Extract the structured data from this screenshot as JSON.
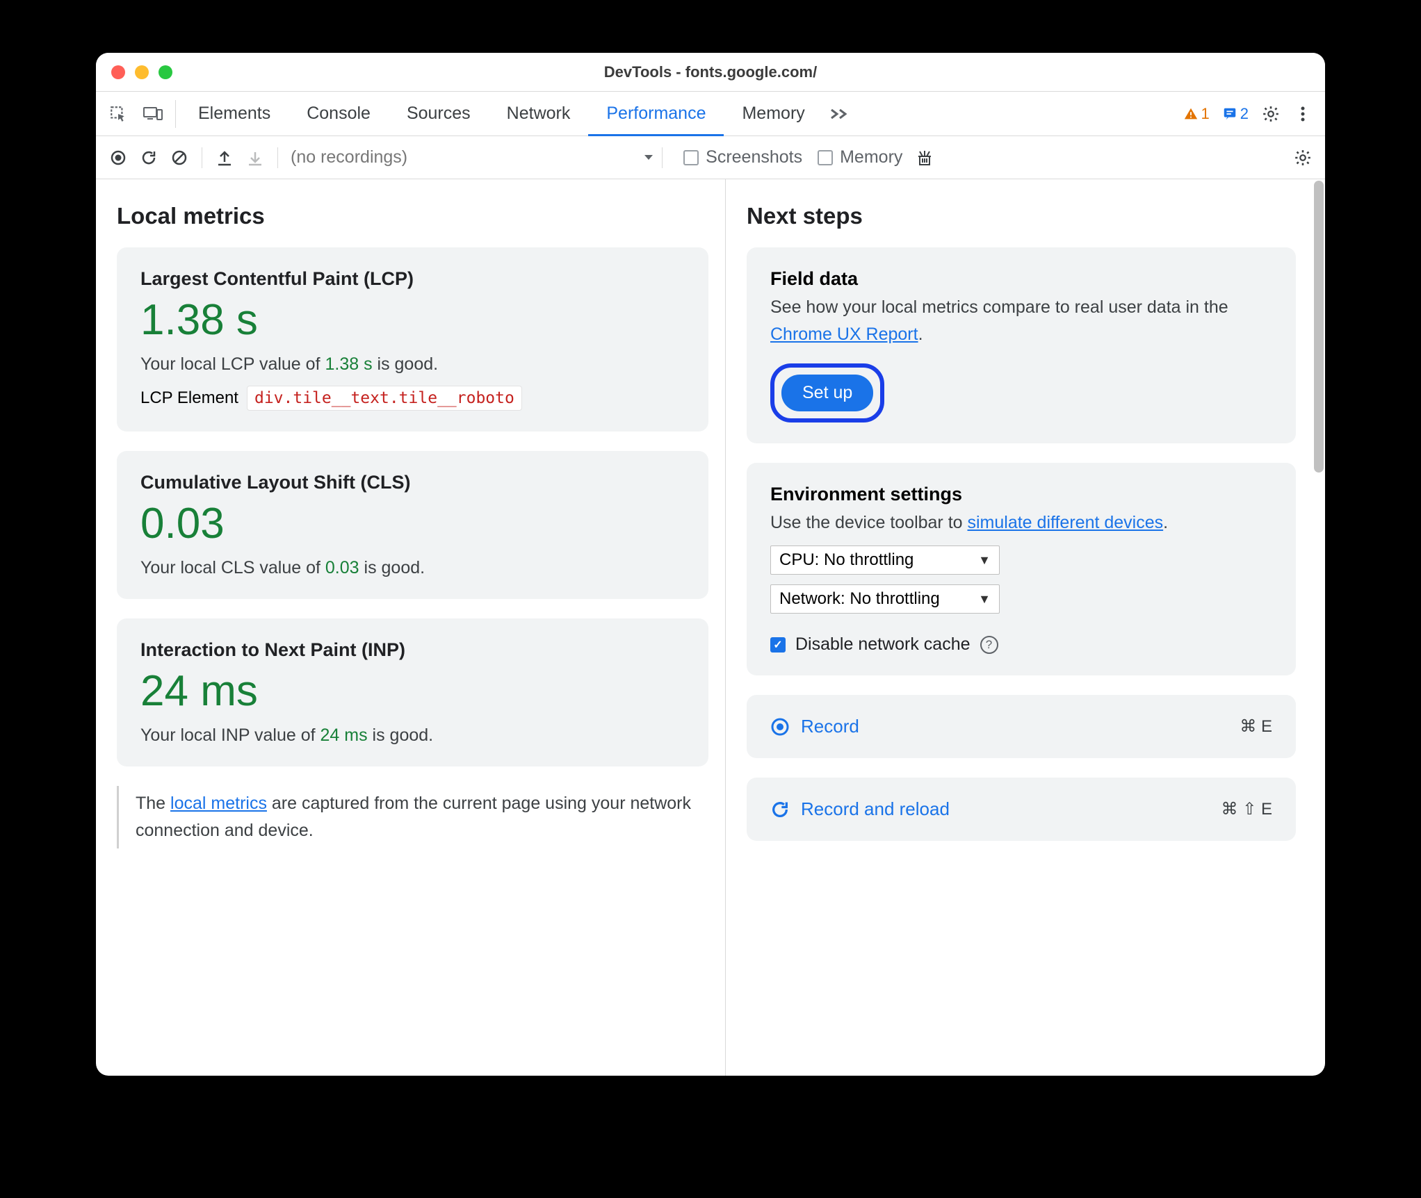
{
  "window": {
    "title": "DevTools - fonts.google.com/"
  },
  "tabs": {
    "items": [
      "Elements",
      "Console",
      "Sources",
      "Network",
      "Performance",
      "Memory"
    ],
    "active_index": 4
  },
  "warnings": {
    "warn_count": "1",
    "info_count": "2"
  },
  "toolbar": {
    "recordings_placeholder": "(no recordings)",
    "screenshots_label": "Screenshots",
    "memory_label": "Memory"
  },
  "left": {
    "heading": "Local metrics",
    "lcp": {
      "title": "Largest Contentful Paint (LCP)",
      "value": "1.38 s",
      "line_pre": "Your local LCP value of ",
      "line_val": "1.38 s",
      "line_post": " is good.",
      "elem_label": "LCP Element",
      "elem_value": "div.tile__text.tile__roboto"
    },
    "cls": {
      "title": "Cumulative Layout Shift (CLS)",
      "value": "0.03",
      "line_pre": "Your local CLS value of ",
      "line_val": "0.03",
      "line_post": " is good."
    },
    "inp": {
      "title": "Interaction to Next Paint (INP)",
      "value": "24 ms",
      "line_pre": "Your local INP value of ",
      "line_val": "24 ms",
      "line_post": " is good."
    },
    "note_pre": "The ",
    "note_link": "local metrics",
    "note_post": " are captured from the current page using your network connection and device."
  },
  "right": {
    "heading": "Next steps",
    "field": {
      "title": "Field data",
      "body_pre": "See how your local metrics compare to real user data in the ",
      "body_link": "Chrome UX Report",
      "body_post": ".",
      "button": "Set up"
    },
    "env": {
      "title": "Environment settings",
      "body_pre": "Use the device toolbar to ",
      "body_link": "simulate different devices",
      "body_post": ".",
      "cpu_select": "CPU: No throttling",
      "net_select": "Network: No throttling",
      "disable_cache": "Disable network cache"
    },
    "record": {
      "label": "Record",
      "shortcut": "⌘ E"
    },
    "reload": {
      "label": "Record and reload",
      "shortcut": "⌘ ⇧ E"
    }
  }
}
